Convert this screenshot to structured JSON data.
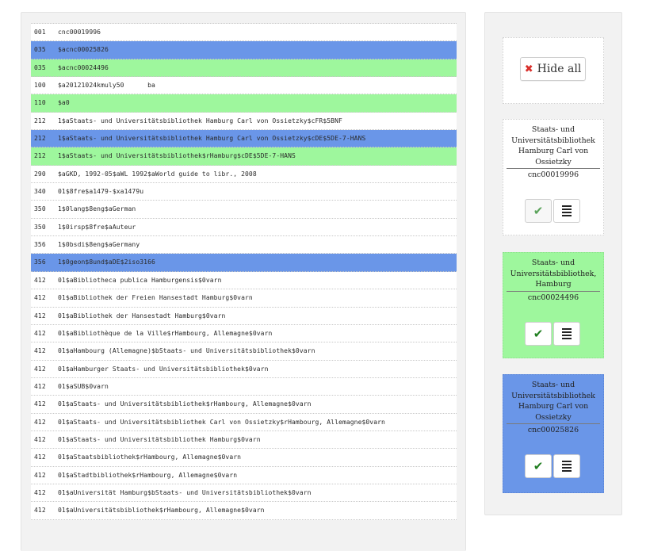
{
  "records": [
    {
      "tag": "001",
      "value": "cnc00019996",
      "highlight": "none"
    },
    {
      "tag": "035",
      "value": "$acnc00025826",
      "highlight": "blue"
    },
    {
      "tag": "035",
      "value": "$acnc00024496",
      "highlight": "green"
    },
    {
      "tag": "100",
      "value": "$a20121024kmuly50      ba",
      "highlight": "none"
    },
    {
      "tag": "110",
      "value": "$a0",
      "highlight": "green"
    },
    {
      "tag": "212",
      "value": "1$aStaats- und Universitätsbibliothek Hamburg Carl von Ossietzky$cFR$5BNF",
      "highlight": "none"
    },
    {
      "tag": "212",
      "value": "1$aStaats- und Universitätsbibliothek Hamburg Carl von Ossietzky$cDE$5DE-7-HANS",
      "highlight": "blue"
    },
    {
      "tag": "212",
      "value": "1$aStaats- und Universitätsbibliothek$rHamburg$cDE$5DE-7-HANS",
      "highlight": "green"
    },
    {
      "tag": "290",
      "value": "$aGKD, 1992-05$aWL 1992$aWorld guide to libr., 2008",
      "highlight": "none"
    },
    {
      "tag": "340",
      "value": "01$8fre$a1479-$xa1479u",
      "highlight": "none"
    },
    {
      "tag": "350",
      "value": "1$0lang$8eng$aGerman",
      "highlight": "none"
    },
    {
      "tag": "350",
      "value": "1$0irsp$8fre$aAuteur",
      "highlight": "none"
    },
    {
      "tag": "356",
      "value": "1$0bsdi$8eng$aGermany",
      "highlight": "none"
    },
    {
      "tag": "356",
      "value": "1$0geon$8und$aDE$2iso3166",
      "highlight": "blue"
    },
    {
      "tag": "412",
      "value": "01$aBibliotheca publica Hamburgensis$0varn",
      "highlight": "none"
    },
    {
      "tag": "412",
      "value": "01$aBibliothek der Freien Hansestadt Hamburg$0varn",
      "highlight": "none"
    },
    {
      "tag": "412",
      "value": "01$aBibliothek der Hansestadt Hamburg$0varn",
      "highlight": "none"
    },
    {
      "tag": "412",
      "value": "01$aBibliothèque de la Ville$rHambourg, Allemagne$0varn",
      "highlight": "none"
    },
    {
      "tag": "412",
      "value": "01$aHambourg (Allemagne)$bStaats- und Universitätsbibliothek$0varn",
      "highlight": "none"
    },
    {
      "tag": "412",
      "value": "01$aHamburger Staats- und Universitätsbibliothek$0varn",
      "highlight": "none"
    },
    {
      "tag": "412",
      "value": "01$aSUB$0varn",
      "highlight": "none"
    },
    {
      "tag": "412",
      "value": "01$aStaats- und Universitätsbibliothek$rHambourg, Allemagne$0varn",
      "highlight": "none"
    },
    {
      "tag": "412",
      "value": "01$aStaats- und Universitätsbibliothek Carl von Ossietzky$rHambourg, Allemagne$0varn",
      "highlight": "none"
    },
    {
      "tag": "412",
      "value": "01$aStaats- und Universitätsbibliothek Hamburg$0varn",
      "highlight": "none"
    },
    {
      "tag": "412",
      "value": "01$aStaatsbibliothek$rHambourg, Allemagne$0varn",
      "highlight": "none"
    },
    {
      "tag": "412",
      "value": "01$aStadtbibliothek$rHambourg, Allemagne$0varn",
      "highlight": "none"
    },
    {
      "tag": "412",
      "value": "01$aUniversität Hamburg$bStaats- und Universitätsbibliothek$0varn",
      "highlight": "none"
    },
    {
      "tag": "412",
      "value": "01$aUniversitätsbibliothek$rHambourg, Allemagne$0varn",
      "highlight": "none"
    }
  ],
  "hide_all_label": "Hide all",
  "cards": [
    {
      "title": "Staats- und Universitätsbibliothek Hamburg Carl von Ossietzky",
      "id": "cnc00019996",
      "color": "#ffffff"
    },
    {
      "title": "Staats- und Universitätsbibliothek, Hamburg",
      "id": "cnc00024496",
      "color": "#9ef79d"
    },
    {
      "title": "Staats- und Universitätsbibliothek Hamburg Carl von Ossietzky",
      "id": "cnc00025826",
      "color": "#6a96e8"
    }
  ],
  "colors": {
    "blue": "#6a96e8",
    "green": "#9ef79d",
    "close": "#d9302c",
    "check": "#1f7d1f"
  },
  "icons": {
    "hide": "close-icon",
    "confirm": "check-icon",
    "details": "list-icon"
  }
}
